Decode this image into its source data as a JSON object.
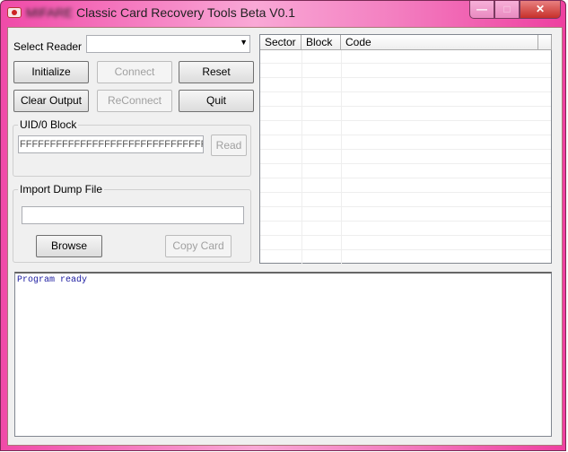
{
  "window": {
    "title_prefix": "MIFARE",
    "title_rest": " Classic Card Recovery Tools Beta V0.1",
    "minimize": "—",
    "maximize": "□",
    "close": "✕"
  },
  "reader": {
    "label": "Select Reader",
    "value": "",
    "arrow": "▼"
  },
  "buttons": {
    "initialize": "Initialize",
    "connect": "Connect",
    "reset": "Reset",
    "clear_output": "Clear Output",
    "reconnect": "ReConnect",
    "quit": "Quit",
    "read": "Read",
    "browse": "Browse",
    "copy_card": "Copy Card"
  },
  "uid_group": {
    "label": "UID/0 Block",
    "value": "FFFFFFFFFFFFFFFFFFFFFFFFFFFFFFFF"
  },
  "import_group": {
    "label": "Import Dump File",
    "value": ""
  },
  "table": {
    "columns": [
      "Sector",
      "Block",
      "Code"
    ]
  },
  "output": {
    "text": "Program ready"
  }
}
